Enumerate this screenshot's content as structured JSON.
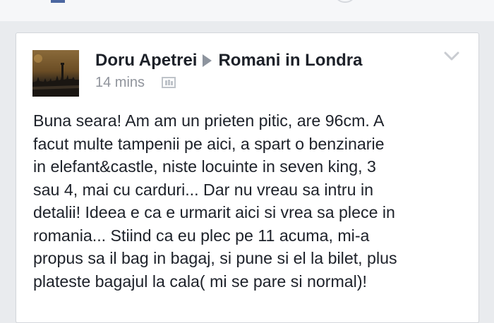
{
  "post": {
    "author": "Doru Apetrei",
    "group": "Romani in Londra",
    "timestamp": "14 mins",
    "icons": {
      "share_arrow": "triangle-right-icon",
      "audience": "group-audience-icon",
      "menu": "chevron-down-icon"
    },
    "body_lines": [
      "Buna seara! Am am un prieten pitic, are 96cm. A",
      "facut multe tampenii pe aici, a spart o benzinarie",
      "in elefant&castle, niste locuinte in seven king, 3",
      "sau 4, mai cu carduri... Dar nu vreau sa intru in",
      "detalii! Ideea e ca e urmarit aici si vrea sa plece in",
      "romania... Stiind ca eu plec pe 11 acuma, mi-a",
      "propus sa il bag in bagaj, si pune si el la bilet, plus",
      "plateste bagajul la cala( mi se pare si normal)!"
    ]
  },
  "colors": {
    "page_bg": "#e9ebee",
    "card_bg": "#ffffff",
    "text": "#1d2129",
    "muted": "#90949c",
    "brand": "#4b67a1"
  }
}
